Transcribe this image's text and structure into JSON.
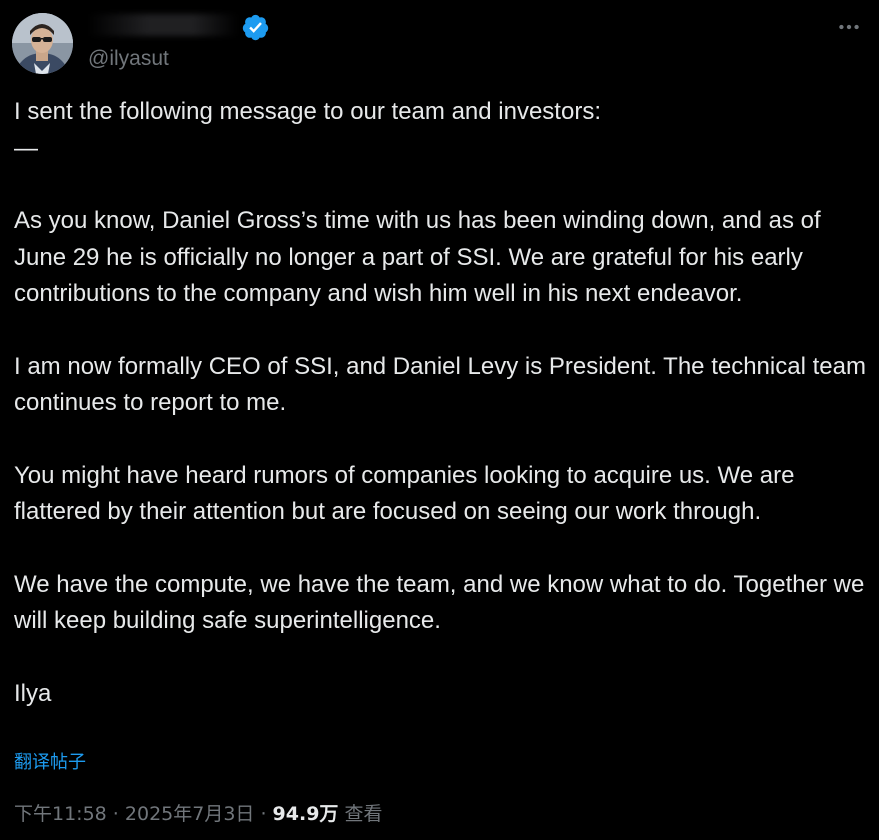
{
  "author": {
    "display_name": "",
    "handle": "@ilyasut",
    "verified": true,
    "avatar_icon": "profile-photo"
  },
  "tweet": {
    "intro": "I sent the following message to our team and investors:\n—",
    "paragraphs": [
      "As you know, Daniel Gross’s time with us has been winding down, and as of June 29 he is officially no longer a part of SSI. We are grateful for his early contributions to the company and wish him well in his next endeavor.",
      "I am now formally CEO of SSI, and Daniel Levy is President. The technical team continues to report to me.",
      "You might have heard rumors of companies looking to acquire us. We are flattered by their attention but are focused on seeing our work through.",
      "We have the compute, we have the team, and we know what to do. Together we will keep building safe superintelligence."
    ],
    "signature": "Ilya"
  },
  "translate_label": "翻译帖子",
  "meta": {
    "time": "下午11:58",
    "separator": " · ",
    "date": "2025年7月3日",
    "views_count": "94.9万",
    "views_label": " 查看"
  },
  "colors": {
    "background": "#000000",
    "text": "#e7e9ea",
    "secondary": "#71767b",
    "link": "#1d9bf0",
    "verified_badge": "#1d9bf0"
  },
  "icons": {
    "verified": "verified-badge-icon",
    "more": "more-options-icon"
  }
}
